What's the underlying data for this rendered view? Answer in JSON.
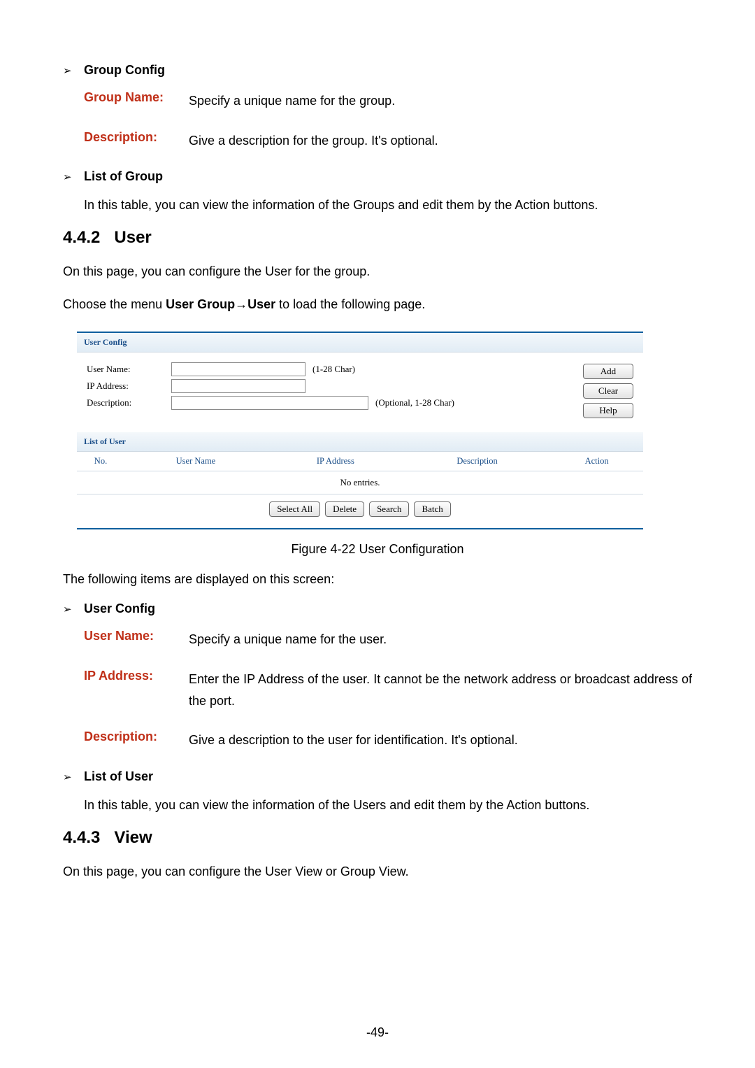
{
  "section1": {
    "bullet_glyph": "➢",
    "title": "Group Config",
    "items": [
      {
        "label": "Group Name:",
        "value": "Specify a unique name for the group."
      },
      {
        "label": "Description:",
        "value": "Give a description for the group. It's optional."
      }
    ]
  },
  "section2": {
    "bullet_glyph": "➢",
    "title": "List of Group",
    "para": "In this table, you can view the information of the Groups and edit them by the Action buttons."
  },
  "heading1": {
    "num": "4.4.2",
    "title": "User"
  },
  "user_intro": "On this page, you can configure the User for the group.",
  "menu_line": {
    "prefix": "Choose the menu ",
    "bold1": "User Group",
    "arrow": "→",
    "bold2": "User",
    "suffix": " to load the following page."
  },
  "ui": {
    "panel1_title": "User Config",
    "form": {
      "user_name_label": "User Name:",
      "user_name_hint": "(1-28 Char)",
      "ip_label": "IP Address:",
      "desc_label": "Description:",
      "desc_hint": "(Optional, 1-28 Char)"
    },
    "buttons": {
      "add": "Add",
      "clear": "Clear",
      "help": "Help"
    },
    "panel2_title": "List of User",
    "cols": {
      "no": "No.",
      "user": "User Name",
      "ip": "IP Address",
      "desc": "Description",
      "action": "Action"
    },
    "empty": "No entries.",
    "pills": {
      "select_all": "Select All",
      "delete": "Delete",
      "search": "Search",
      "batch": "Batch"
    }
  },
  "figure_caption": "Figure 4-22 User Configuration",
  "items_displayed": "The following items are displayed on this screen:",
  "section3": {
    "bullet_glyph": "➢",
    "title": "User Config",
    "items": [
      {
        "label": "User Name:",
        "value": "Specify a unique name for the user."
      },
      {
        "label": "IP Address:",
        "value": "Enter the IP Address of the user. It cannot be the network address or broadcast address of the port."
      },
      {
        "label": "Description:",
        "value": "Give a description to the user for identification. It's optional."
      }
    ]
  },
  "section4": {
    "bullet_glyph": "➢",
    "title": "List of User",
    "para": "In this table, you can view the information of the Users and edit them by the Action buttons."
  },
  "heading2": {
    "num": "4.4.3",
    "title": "View"
  },
  "view_intro": "On this page, you can configure the User View or Group View.",
  "page_number": "-49-"
}
